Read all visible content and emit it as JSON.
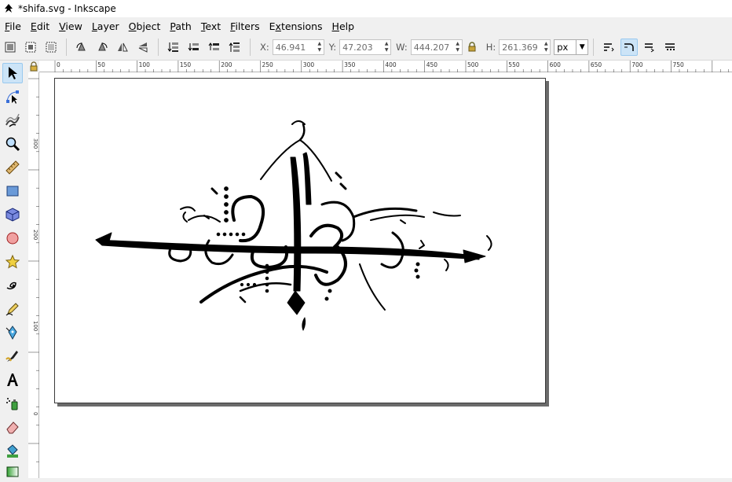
{
  "window": {
    "title": "*shifa.svg - Inkscape"
  },
  "menu": [
    {
      "label": "File",
      "accel": "F",
      "rest": "ile"
    },
    {
      "label": "Edit",
      "accel": "E",
      "rest": "dit"
    },
    {
      "label": "View",
      "accel": "V",
      "rest": "iew"
    },
    {
      "label": "Layer",
      "accel": "L",
      "rest": "ayer"
    },
    {
      "label": "Object",
      "accel": "O",
      "rest": "bject"
    },
    {
      "label": "Path",
      "accel": "P",
      "rest": "ath"
    },
    {
      "label": "Text",
      "accel": "T",
      "rest": "ext"
    },
    {
      "label": "Filters",
      "accel": "F",
      "rest": "ilters"
    },
    {
      "label": "Extensions",
      "accel": "x",
      "pre": "E",
      "rest": "tensions"
    },
    {
      "label": "Help",
      "accel": "H",
      "rest": "elp"
    }
  ],
  "selectbar": {
    "x_label": "X:",
    "x_value": "46.941",
    "y_label": "Y:",
    "y_value": "47.203",
    "w_label": "W:",
    "w_value": "444.207",
    "h_label": "H:",
    "h_value": "261.369",
    "unit": "px"
  },
  "rulers": {
    "h_labels": [
      "0",
      "50",
      "100",
      "150",
      "200",
      "250",
      "300",
      "350",
      "400",
      "450",
      "500",
      "550",
      "600",
      "650",
      "700",
      "750"
    ],
    "v_labels": [
      "300",
      "200",
      "100",
      "0"
    ]
  },
  "colors": {
    "accent": "#cce4f7",
    "accent_border": "#99c9ef",
    "artwork": "#000000"
  }
}
